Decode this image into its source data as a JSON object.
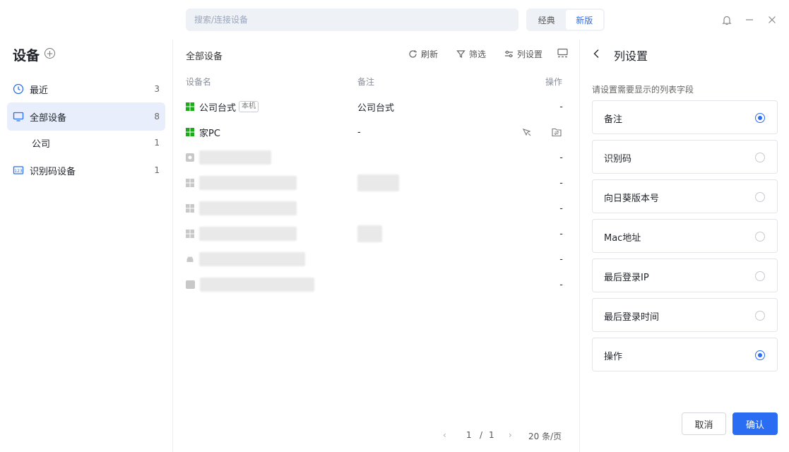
{
  "titlebar": {
    "search_placeholder": "搜索/连接设备",
    "version_classic": "经典",
    "version_new": "新版"
  },
  "sidebar": {
    "title": "设备",
    "items": [
      {
        "label": "最近",
        "count": "3"
      },
      {
        "label": "全部设备",
        "count": "8"
      },
      {
        "label": "公司",
        "count": "1"
      },
      {
        "label": "识别码设备",
        "count": "1"
      }
    ]
  },
  "main": {
    "title": "全部设备",
    "toolbar": {
      "refresh": "刷新",
      "filter": "筛选",
      "columns": "列设置"
    },
    "columns": {
      "name": "设备名",
      "note": "备注",
      "action": "操作"
    },
    "rows": [
      {
        "name": "公司台式",
        "badge": "本机",
        "note": "公司台式",
        "action": "-"
      },
      {
        "name": "家PC",
        "note": "-"
      },
      {
        "action": "-"
      },
      {
        "action": "-"
      },
      {
        "action": "-"
      },
      {
        "action": "-"
      },
      {
        "action": "-"
      },
      {
        "action": "-"
      }
    ],
    "pager": {
      "page": "1",
      "sep": "/",
      "total": "1",
      "per_page": "20 条/页"
    }
  },
  "panel": {
    "title": "列设置",
    "hint": "请设置需要显示的列表字段",
    "options": [
      {
        "label": "备注",
        "checked": true
      },
      {
        "label": "识别码",
        "checked": false
      },
      {
        "label": "向日葵版本号",
        "checked": false
      },
      {
        "label": "Mac地址",
        "checked": false
      },
      {
        "label": "最后登录IP",
        "checked": false
      },
      {
        "label": "最后登录时间",
        "checked": false
      },
      {
        "label": "操作",
        "checked": true
      }
    ],
    "cancel": "取消",
    "confirm": "确认"
  },
  "colors": {
    "accent": "#2b6df2",
    "windows_green": "#1aad19",
    "selected_bg": "#e8eefc"
  }
}
